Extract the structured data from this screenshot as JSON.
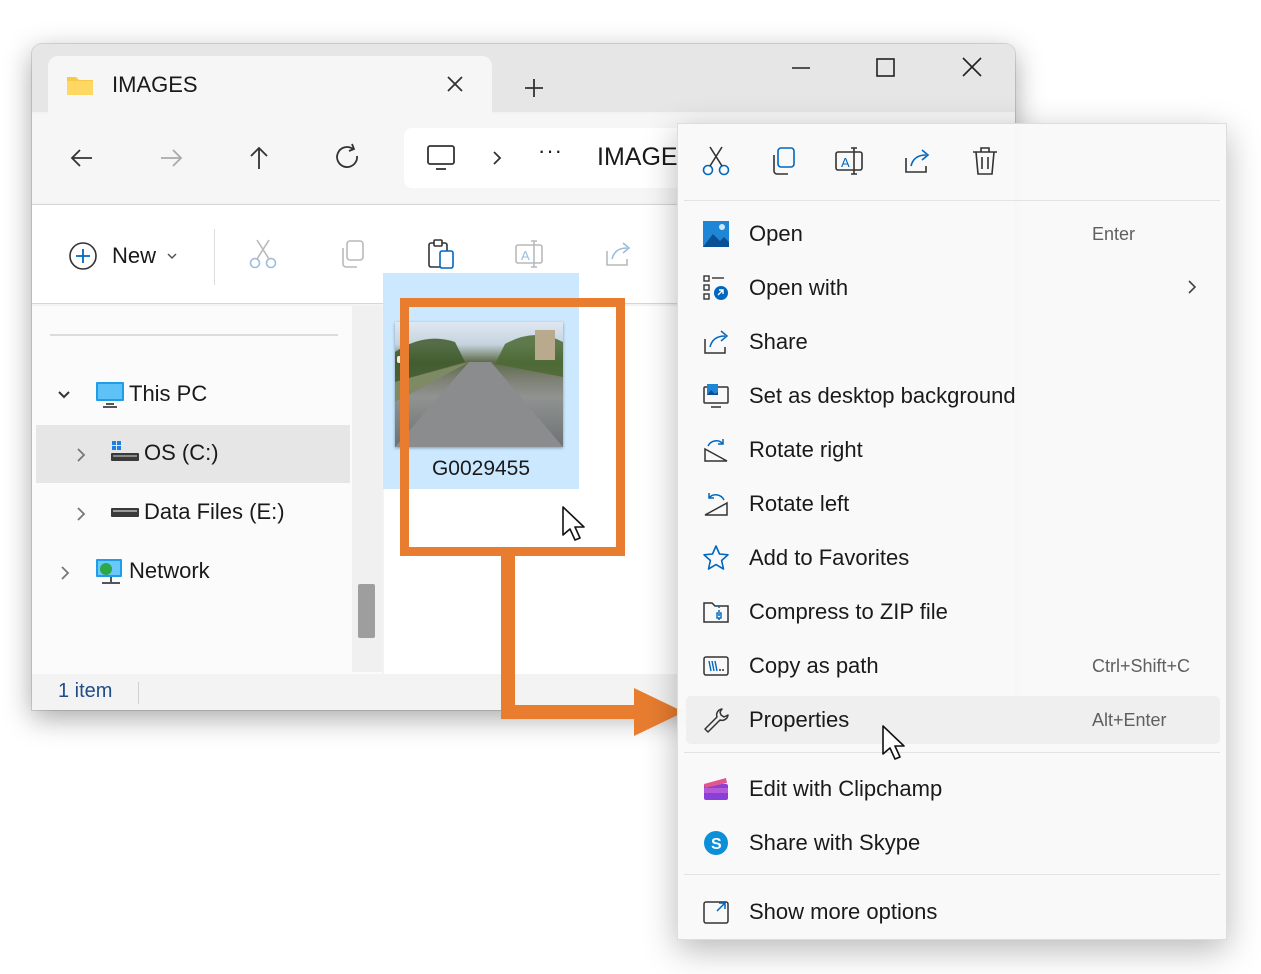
{
  "window": {
    "tab_title": "IMAGES",
    "address_overflow": "···",
    "address_text": "IMAGE"
  },
  "command_bar": {
    "new_label": "New"
  },
  "nav_tree": [
    {
      "label": "This PC",
      "icon": "this-pc-icon",
      "expanded": true
    },
    {
      "label": "OS (C:)",
      "icon": "os-drive-icon",
      "selected": true
    },
    {
      "label": "Data Files (E:)",
      "icon": "drive-icon"
    },
    {
      "label": "Network",
      "icon": "network-icon"
    }
  ],
  "file": {
    "name": "G0029455",
    "thumbnail": "street-photo"
  },
  "status": {
    "item_count": "1 item"
  },
  "context_menu": {
    "top_actions": [
      "cut-icon",
      "copy-icon",
      "rename-icon",
      "share-icon",
      "delete-icon"
    ],
    "items": [
      {
        "label": "Open",
        "shortcut": "Enter",
        "icon": "photos-app-icon"
      },
      {
        "label": "Open with",
        "shortcut": "",
        "icon": "open-with-icon",
        "submenu": true
      },
      {
        "label": "Share",
        "shortcut": "",
        "icon": "share-icon"
      },
      {
        "label": "Set as desktop background",
        "shortcut": "",
        "icon": "desktop-background-icon"
      },
      {
        "label": "Rotate right",
        "shortcut": "",
        "icon": "rotate-right-icon"
      },
      {
        "label": "Rotate left",
        "shortcut": "",
        "icon": "rotate-left-icon"
      },
      {
        "label": "Add to Favorites",
        "shortcut": "",
        "icon": "star-icon"
      },
      {
        "label": "Compress to ZIP file",
        "shortcut": "",
        "icon": "zip-icon"
      },
      {
        "label": "Copy as path",
        "shortcut": "Ctrl+Shift+C",
        "icon": "copy-path-icon"
      },
      {
        "label": "Properties",
        "shortcut": "Alt+Enter",
        "icon": "wrench-icon",
        "hovered": true
      },
      {
        "label": "Edit with Clipchamp",
        "shortcut": "",
        "icon": "clipchamp-icon"
      },
      {
        "label": "Share with Skype",
        "shortcut": "",
        "icon": "skype-icon"
      },
      {
        "label": "Show more options",
        "shortcut": "",
        "icon": "more-options-icon"
      }
    ]
  },
  "colors": {
    "highlight_annotation": "#e87d2f",
    "selection": "#cce8ff",
    "accent": "#0067c0"
  }
}
